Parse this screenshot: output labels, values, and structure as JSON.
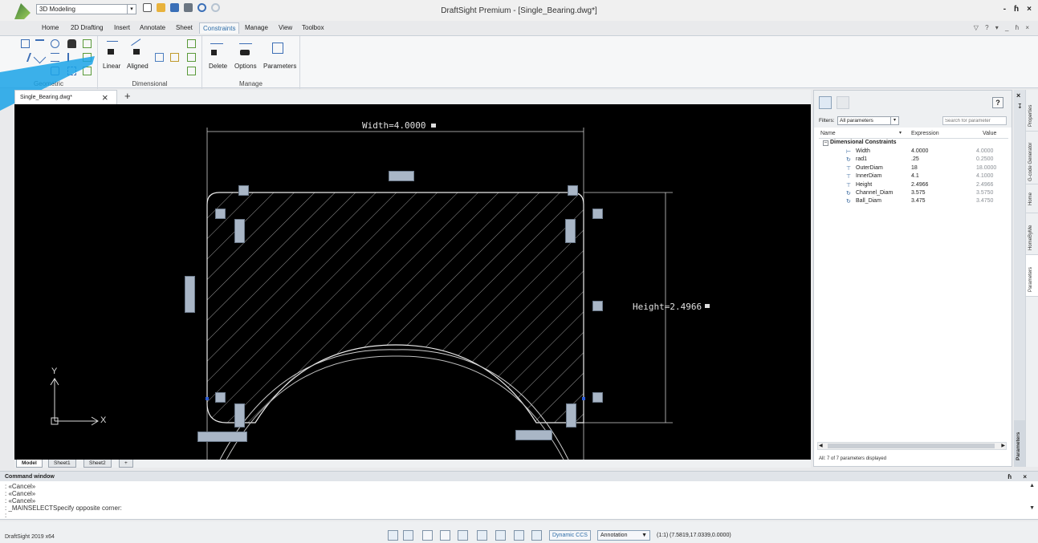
{
  "titlebar": {
    "workspace": "3D Modeling",
    "window_title": "DraftSight Premium - [Single_Bearing.dwg*]",
    "controls": [
      "-",
      "ɦ",
      "×"
    ]
  },
  "ribbon": {
    "tabs": [
      "Home",
      "2D Drafting",
      "Insert",
      "Annotate",
      "Sheet",
      "Constraints",
      "Manage",
      "View",
      "Toolbox"
    ],
    "active_tab": "Constraints",
    "right_controls": "▽ ? ▾ _ ɦ ×",
    "panels": {
      "geometric": {
        "title": "Geometric"
      },
      "dimensional": {
        "title": "Dimensional",
        "linear_label": "Linear",
        "aligned_label": "Aligned"
      },
      "manage": {
        "title": "Manage",
        "delete_label": "Delete",
        "options_label": "Options",
        "parameters_label": "Parameters"
      }
    }
  },
  "document": {
    "tab_label": "Single_Bearing.dwg*",
    "close_glyph": "×",
    "add_glyph": "+"
  },
  "canvas": {
    "width_dimension": "Width=4.0000",
    "height_dimension": "Height=2.4966",
    "axis_y": "Y",
    "axis_x": "X"
  },
  "layout_tabs": [
    "Model",
    "Sheet1",
    "Sheet2",
    "+"
  ],
  "parameters_palette": {
    "filters_label": "Filters:",
    "filter_value": "All parameters",
    "search_placeholder": "Search for parameter",
    "help": "?",
    "columns": {
      "name": "Name",
      "expression": "Expression",
      "value": "Value"
    },
    "group_name": "Dimensional Constraints",
    "rows": [
      {
        "name": "Width",
        "expression": "4.0000",
        "value": "4.0000",
        "icon": "linear-constraint-icon"
      },
      {
        "name": "rad1",
        "expression": ".25",
        "value": "0.2500",
        "icon": "radius-constraint-icon"
      },
      {
        "name": "OuterDiam",
        "expression": "18",
        "value": "18.0000",
        "icon": "diameter-constraint-icon"
      },
      {
        "name": "InnerDiam",
        "expression": "4.1",
        "value": "4.1000",
        "icon": "diameter-constraint-icon"
      },
      {
        "name": "Height",
        "expression": "2.4966",
        "value": "2.4966",
        "icon": "linear-constraint-icon"
      },
      {
        "name": "Channel_Diam",
        "expression": "3.575",
        "value": "3.5750",
        "icon": "radius-constraint-icon"
      },
      {
        "name": "Ball_Diam",
        "expression": "3.475",
        "value": "3.4750",
        "icon": "radius-constraint-icon"
      }
    ],
    "status": "All: 7 of 7 parameters displayed",
    "vertical_tab": "Parameters"
  },
  "side_tabs": [
    "Properties",
    "G-code Generator",
    "Home",
    "HomeByMe",
    "Parameters"
  ],
  "command_window": {
    "title": "Command window",
    "controls": "ɦ ×",
    "lines": [
      ": «Cancel»",
      ": «Cancel»",
      ": «Cancel»",
      ": _MAINSELECTSpecify opposite corner:",
      ":"
    ]
  },
  "statusbar": {
    "version": "DraftSight 2019 x64",
    "dynamic_ccs": "Dynamic CCS",
    "annotation": "Annotation",
    "annotation_chevron": "▼",
    "scale": "(1:1)",
    "coordinates": "(7.5819,17.0339,0.0000)"
  },
  "colors": {
    "accent": "#2e6da8",
    "canvas_bg": "#000000",
    "geometry": "#e6e6e6",
    "constraint_badge": "#a9b6c6"
  }
}
